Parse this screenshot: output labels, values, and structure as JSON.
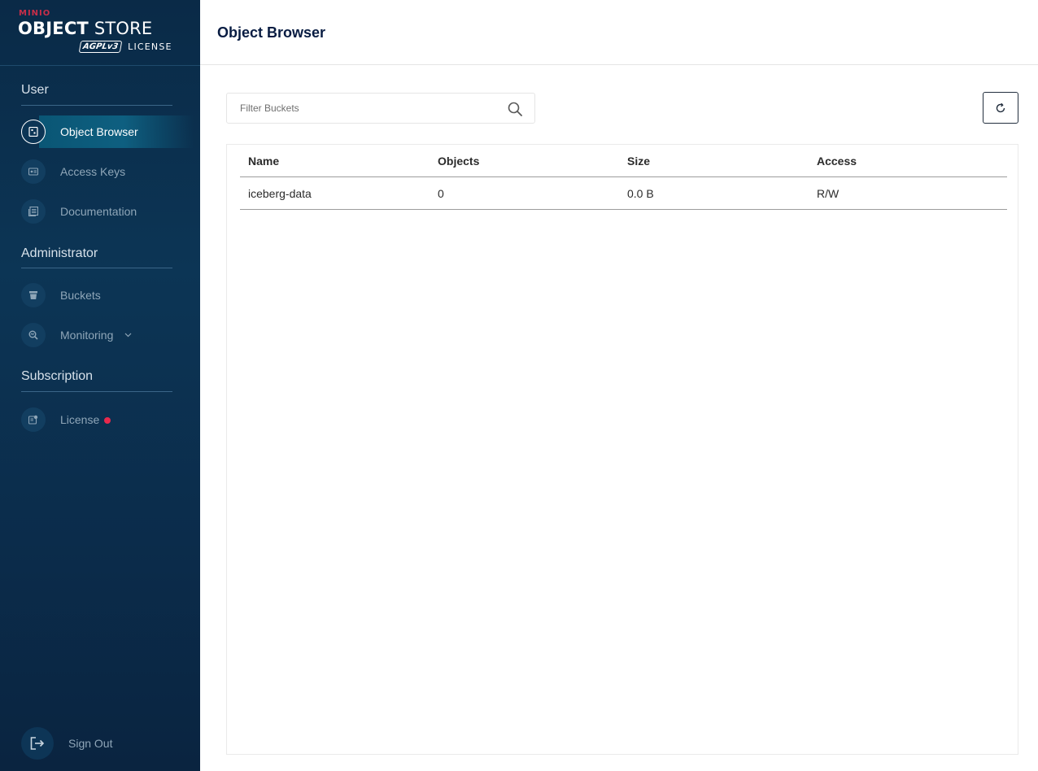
{
  "logo": {
    "brand": "MINIO",
    "product_bold": "OBJECT",
    "product_rest": " STORE",
    "agpl": "AGPLv3",
    "license": "LICENSE"
  },
  "sidebar": {
    "sections": [
      {
        "title": "User",
        "items": [
          {
            "label": "Object Browser",
            "icon": "object-browser-icon",
            "active": true
          },
          {
            "label": "Access Keys",
            "icon": "access-keys-icon"
          },
          {
            "label": "Documentation",
            "icon": "documentation-icon"
          }
        ]
      },
      {
        "title": "Administrator",
        "items": [
          {
            "label": "Buckets",
            "icon": "bucket-icon"
          },
          {
            "label": "Monitoring",
            "icon": "monitoring-icon",
            "expandable": true
          }
        ]
      },
      {
        "title": "Subscription",
        "items": [
          {
            "label": "License",
            "icon": "license-icon",
            "badge": "red-dot"
          }
        ]
      }
    ],
    "signout_label": "Sign Out"
  },
  "header": {
    "title": "Object Browser"
  },
  "filter": {
    "placeholder": "Filter Buckets",
    "value": ""
  },
  "colors": {
    "sidebar": "#0c3555",
    "accent_red": "#c72e49",
    "badge": "#e8294c"
  },
  "table": {
    "columns": [
      "Name",
      "Objects",
      "Size",
      "Access"
    ],
    "rows": [
      [
        "iceberg-data",
        "0",
        "0.0 B",
        "R/W"
      ]
    ]
  }
}
